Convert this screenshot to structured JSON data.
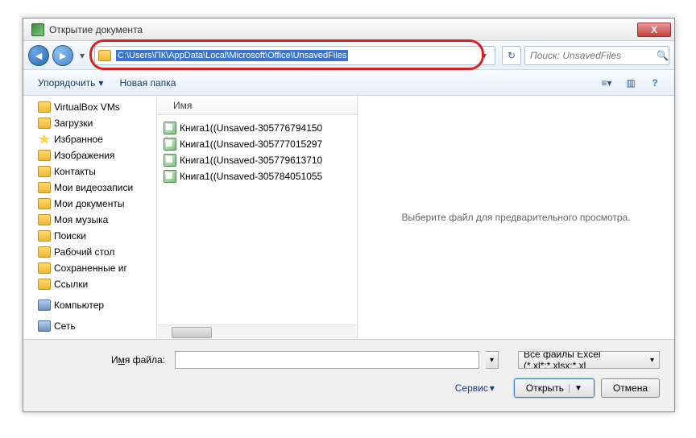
{
  "title": "Открытие документа",
  "close": "X",
  "address_path": "C:\\Users\\ПК\\AppData\\Local\\Microsoft\\Office\\UnsavedFiles",
  "search_placeholder": "Поиск: UnsavedFiles",
  "toolbar": {
    "organize": "Упорядочить",
    "new_folder": "Новая папка"
  },
  "tree": [
    {
      "label": "VirtualBox VMs",
      "icon": "folder-i"
    },
    {
      "label": "Загрузки",
      "icon": "folder-i"
    },
    {
      "label": "Избранное",
      "icon": "star-i"
    },
    {
      "label": "Изображения",
      "icon": "folder-i"
    },
    {
      "label": "Контакты",
      "icon": "folder-i"
    },
    {
      "label": "Мои видеозаписи",
      "icon": "folder-i"
    },
    {
      "label": "Мои документы",
      "icon": "folder-i"
    },
    {
      "label": "Моя музыка",
      "icon": "folder-i"
    },
    {
      "label": "Поиски",
      "icon": "folder-i"
    },
    {
      "label": "Рабочий стол",
      "icon": "folder-i"
    },
    {
      "label": "Сохраненные иг",
      "icon": "folder-i"
    },
    {
      "label": "Ссылки",
      "icon": "folder-i"
    },
    {
      "label": "Компьютер",
      "icon": "comp-i",
      "sep": true
    },
    {
      "label": "Сеть",
      "icon": "comp-i",
      "sep": true
    }
  ],
  "column_header": "Имя",
  "files": [
    "Книга1((Unsaved-305776794150",
    "Книга1((Unsaved-305777015297",
    "Книга1((Unsaved-305779613710",
    "Книга1((Unsaved-305784051055"
  ],
  "preview_text": "Выберите файл для предварительного просмотра.",
  "footer": {
    "filename_label_pre": "И",
    "filename_label_u": "м",
    "filename_label_post": "я файла:",
    "filter": "Все файлы Excel (*.xl*;*.xlsx;*.xl",
    "service": "Сервис",
    "open": "Открыть",
    "cancel": "Отмена"
  }
}
